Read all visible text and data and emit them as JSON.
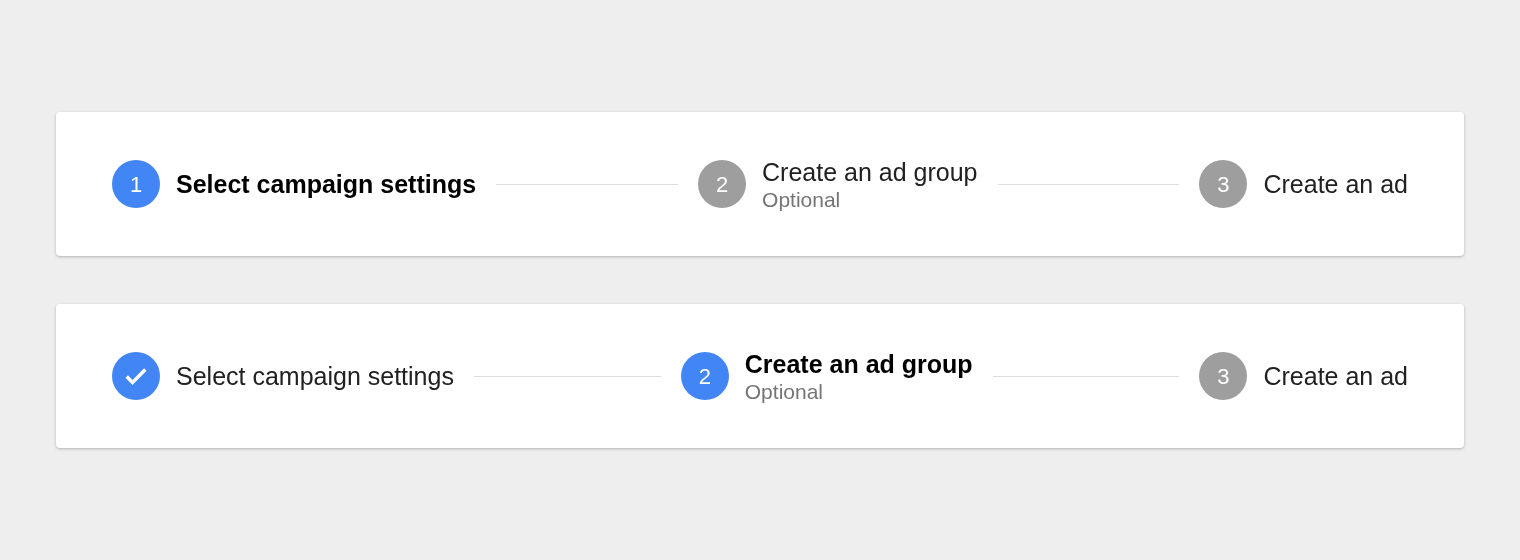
{
  "steppers": [
    {
      "steps": [
        {
          "number": "1",
          "label": "Select campaign settings",
          "completed": false,
          "selected": true
        },
        {
          "number": "2",
          "label": "Create an ad group",
          "sublabel": "Optional",
          "completed": false,
          "selected": false
        },
        {
          "number": "3",
          "label": "Create an ad",
          "completed": false,
          "selected": false
        }
      ]
    },
    {
      "steps": [
        {
          "label": "Select campaign settings",
          "completed": true,
          "selected": false
        },
        {
          "number": "2",
          "label": "Create an ad group",
          "sublabel": "Optional",
          "completed": false,
          "selected": true
        },
        {
          "number": "3",
          "label": "Create an ad",
          "completed": false,
          "selected": false
        }
      ]
    }
  ]
}
